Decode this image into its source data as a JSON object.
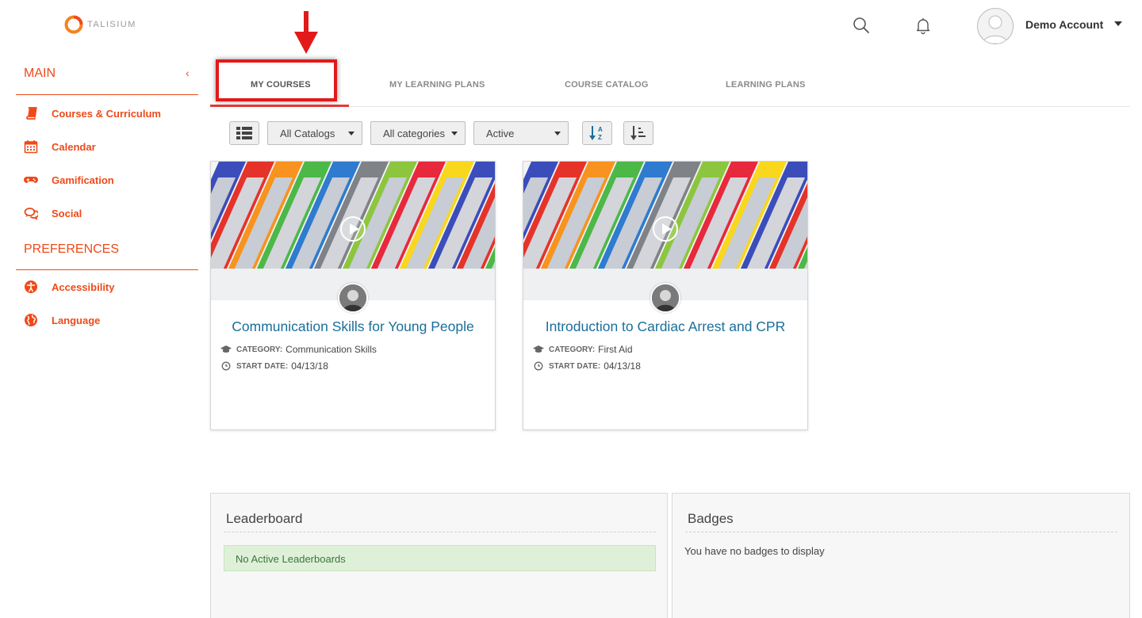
{
  "header": {
    "logo_text": "TALISIUM",
    "account_name": "Demo Account",
    "icons": [
      "search-icon",
      "bell-icon",
      "avatar",
      "caret-down-icon"
    ]
  },
  "sidebar": {
    "main_heading": "MAIN",
    "collapse_glyph": "‹",
    "main_items": [
      {
        "label": "Courses & Curriculum",
        "icon": "book-icon"
      },
      {
        "label": "Calendar",
        "icon": "calendar-icon"
      },
      {
        "label": "Gamification",
        "icon": "gamepad-icon"
      },
      {
        "label": "Social",
        "icon": "chat-bubbles-icon"
      }
    ],
    "preferences_heading": "PREFERENCES",
    "preference_items": [
      {
        "label": "Accessibility",
        "icon": "accessibility-icon"
      },
      {
        "label": "Language",
        "icon": "globe-icon"
      }
    ]
  },
  "tabs": [
    {
      "label": "MY COURSES",
      "active": true
    },
    {
      "label": "MY LEARNING PLANS",
      "active": false
    },
    {
      "label": "COURSE CATALOG",
      "active": false
    },
    {
      "label": "LEARNING PLANS",
      "active": false
    }
  ],
  "toolbar": {
    "view_toggle_icon": "list-view-icon",
    "catalog_select": "All Catalogs",
    "category_select": "All categories",
    "status_select": "Active",
    "sort_alpha_icon": "sort-alpha-icon",
    "sort_order_icon": "sort-order-icon"
  },
  "courses": [
    {
      "title": "Communication Skills for Young People",
      "category_label": "CATEGORY:",
      "category": "Communication Skills",
      "start_label": "START DATE:",
      "start_date": "04/13/18"
    },
    {
      "title": "Introduction to Cardiac Arrest and CPR",
      "category_label": "CATEGORY:",
      "category": "First Aid",
      "start_label": "START DATE:",
      "start_date": "04/13/18"
    }
  ],
  "leaderboard": {
    "title": "Leaderboard",
    "message": "No Active Leaderboards"
  },
  "badges": {
    "title": "Badges",
    "message": "You have no badges to display"
  },
  "colors": {
    "accent": "#ee4a19",
    "tab_active_underline": "#e53935",
    "course_title": "#1a6f9a",
    "alert_bg": "#dff0d8",
    "alert_text": "#3c763d"
  }
}
